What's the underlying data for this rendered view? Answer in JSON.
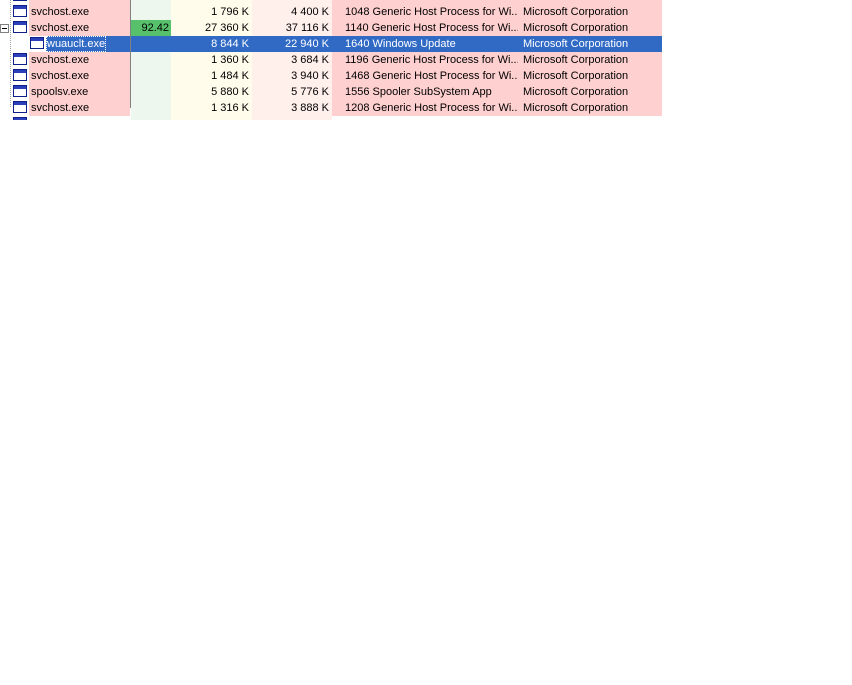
{
  "process_list": {
    "rows": [
      {
        "name": "",
        "cpu": "",
        "private_bytes": "",
        "working_set": "",
        "pid": "",
        "description": "",
        "company": "",
        "level": 0,
        "partial": true
      },
      {
        "name": "svchost.exe",
        "cpu": "",
        "private_bytes": "1 796 K",
        "working_set": "4 400 K",
        "pid": "1048",
        "description": "Generic Host Process for Wi...",
        "company": "Microsoft Corporation",
        "level": 0
      },
      {
        "name": "svchost.exe",
        "cpu": "92.42",
        "private_bytes": "27 360 K",
        "working_set": "37 116 K",
        "pid": "1140",
        "description": "Generic Host Process for Wi...",
        "company": "Microsoft Corporation",
        "level": 0,
        "expanded": true
      },
      {
        "name": "wuauclt.exe",
        "cpu": "",
        "private_bytes": "8 844 K",
        "working_set": "22 940 K",
        "pid": "1640",
        "description": "Windows Update",
        "company": "Microsoft Corporation",
        "level": 1,
        "selected": true
      },
      {
        "name": "svchost.exe",
        "cpu": "",
        "private_bytes": "1 360 K",
        "working_set": "3 684 K",
        "pid": "1196",
        "description": "Generic Host Process for Wi...",
        "company": "Microsoft Corporation",
        "level": 0
      },
      {
        "name": "svchost.exe",
        "cpu": "",
        "private_bytes": "1 484 K",
        "working_set": "3 940 K",
        "pid": "1468",
        "description": "Generic Host Process for Wi...",
        "company": "Microsoft Corporation",
        "level": 0
      },
      {
        "name": "spoolsv.exe",
        "cpu": "",
        "private_bytes": "5 880 K",
        "working_set": "5 776 K",
        "pid": "1556",
        "description": "Spooler SubSystem App",
        "company": "Microsoft Corporation",
        "level": 0
      },
      {
        "name": "svchost.exe",
        "cpu": "",
        "private_bytes": "1 316 K",
        "working_set": "3 888 K",
        "pid": "1208",
        "description": "Generic Host Process for Wi...",
        "company": "Microsoft Corporation",
        "level": 0
      },
      {
        "name": "",
        "cpu": "",
        "private_bytes": "",
        "working_set": "",
        "pid": "",
        "description": "",
        "company": "",
        "level": 0,
        "partial": true
      }
    ]
  },
  "icons": {
    "process": "window-icon",
    "expander": "tree-collapse-icon"
  },
  "colors": {
    "service_row": "#ffd0d0",
    "selection": "#316ac5",
    "cpu_high": "#56c06a",
    "cpu_column": "#eef7ee",
    "private_bytes_column": "#fffcec",
    "working_set_column": "#fff0ec"
  }
}
